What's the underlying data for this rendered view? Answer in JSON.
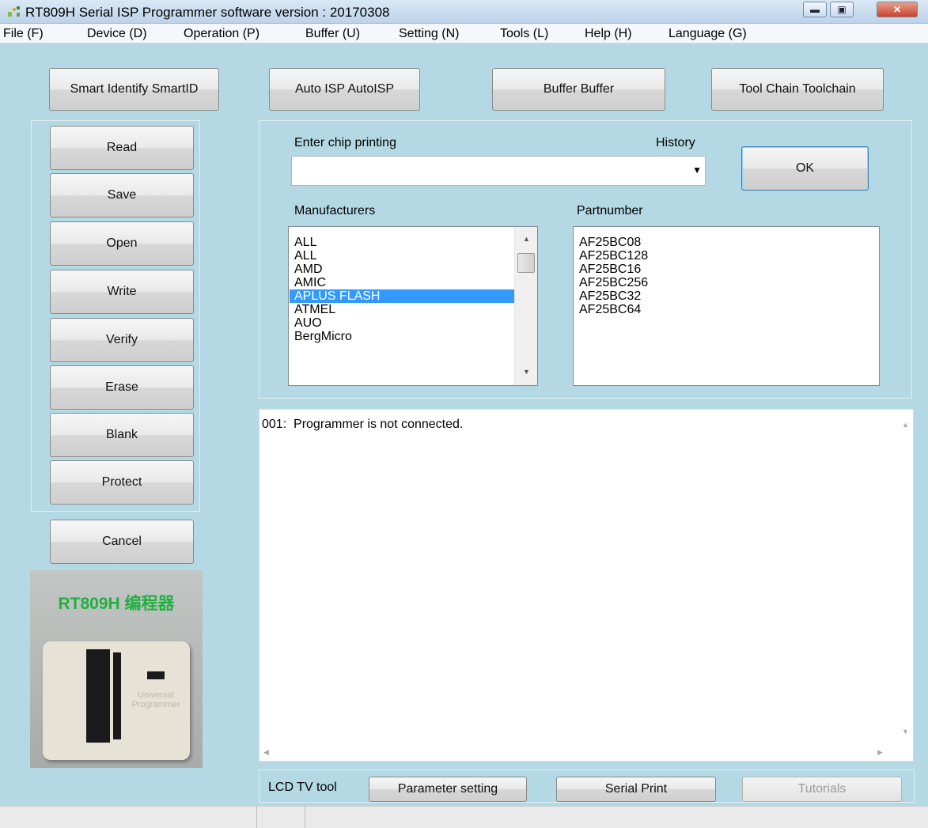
{
  "window": {
    "title": "RT809H Serial ISP Programmer software version : 20170308",
    "icon": "app-icon",
    "controls": [
      "minimize-icon",
      "maximize-icon",
      "close-icon"
    ]
  },
  "menu": {
    "file": "File (F)",
    "device": "Device (D)",
    "operation": "Operation (P)",
    "buffer": "Buffer (U)",
    "setting": "Setting (N)",
    "tools": "Tools (L)",
    "help": "Help (H)",
    "language": "Language (G)"
  },
  "top_buttons": {
    "smart_identify": "Smart Identify SmartID",
    "auto_isp": "Auto ISP AutoISP",
    "buffer": "Buffer Buffer",
    "tool_chain": "Tool Chain Toolchain"
  },
  "side_buttons": {
    "read": "Read",
    "save": "Save",
    "open": "Open",
    "write": "Write",
    "verify": "Verify",
    "erase": "Erase",
    "blank": "Blank",
    "protect": "Protect",
    "cancel": "Cancel"
  },
  "chip_search": {
    "label": "Enter chip printing",
    "history_label": "History",
    "value": "",
    "ok_label": "OK"
  },
  "manufacturers": {
    "label": "Manufacturers",
    "items": [
      "ALL",
      "ALL",
      "AMD",
      "AMIC",
      "APLUS FLASH",
      "ATMEL",
      "AUO",
      "BergMicro"
    ],
    "selected": "APLUS FLASH"
  },
  "partnumbers": {
    "label": "Partnumber",
    "items": [
      "AF25BC08",
      "AF25BC128",
      "AF25BC16",
      "AF25BC256",
      "AF25BC32",
      "AF25BC64"
    ]
  },
  "log": {
    "lines": [
      "001:  Programmer is not connected."
    ]
  },
  "device_image": {
    "caption": "RT809H 编程器",
    "body_text": "Universal Programmer"
  },
  "bottom_tools": {
    "label": "LCD TV tool",
    "parameter_setting": "Parameter setting",
    "serial_print": "Serial Print",
    "tutorials": "Tutorials"
  },
  "colors": {
    "background": "#b4d9e4",
    "selection": "#3399ff",
    "caption_green": "#20b040"
  }
}
